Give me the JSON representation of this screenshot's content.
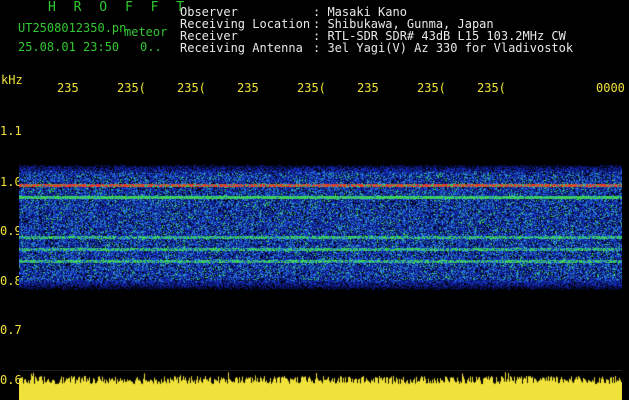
{
  "header": {
    "app_title": "H R O F F T",
    "filename": "UT2508012350.pn",
    "file_kind": "meteor",
    "date_time": "25.08.01 23:50",
    "counter": "0..",
    "fields": [
      {
        "label": "Observer",
        "value": ": Masaki Kano"
      },
      {
        "label": "Receiving Location",
        "value": ": Shibukawa, Gunma, Japan"
      },
      {
        "label": "Receiver",
        "value": ": RTL-SDR SDR# 43dB L15 103.2MHz CW"
      },
      {
        "label": "Receiving Antenna",
        "value": ": 3el Yagi(V) Az 330 for Vladivostok"
      }
    ]
  },
  "axis": {
    "unit": "kHz",
    "time_ticks": [
      "235",
      "235(",
      "235(",
      "235",
      "235(",
      "235",
      "235(",
      "235(",
      "0000"
    ],
    "freq_ticks": [
      "1.1",
      "1.0",
      "0.9",
      "0.8",
      "0.7",
      "0.6"
    ]
  },
  "colors": {
    "text_green": "#31c831",
    "text_white": "#e8e8e8",
    "tick_yellow": "#f0e23a",
    "background": "#000000",
    "noise_blue": "#1a2db8",
    "signal_red": "#e8331f",
    "signal_green": "#33d25c",
    "level_yellow": "#f0e23a"
  },
  "spectrum": {
    "freq_range_khz": [
      0.8,
      1.0
    ],
    "carrier_lines_khz": [
      0.985,
      0.96,
      0.88,
      0.855,
      0.83
    ]
  }
}
